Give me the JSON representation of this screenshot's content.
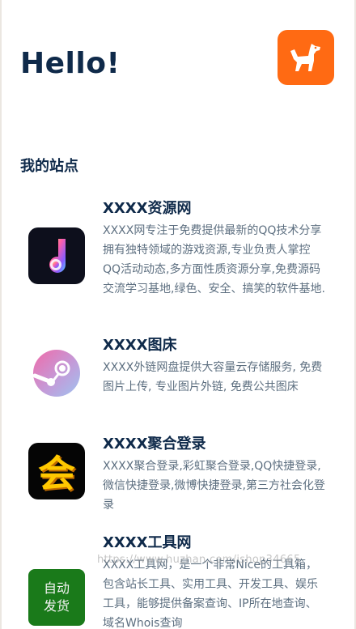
{
  "greeting": "Hello!",
  "section_title": "我的站点",
  "sites": [
    {
      "name": "XXXX资源网",
      "desc": "XXXX网专注于免费提供最新的QQ技术分享拥有独特领域的游戏资源,专业负责人掌控QQ活动动态,多方面性质资源分享,免费源码交流学习基地,绿色、安全、搞笑的软件基地.",
      "icon": "music-note-icon"
    },
    {
      "name": "XXXX图床",
      "desc": "XXXX外链网盘提供大容量云存储服务, 免费图片上传, 专业图片外链, 免费公共图床",
      "icon": "steam-icon"
    },
    {
      "name": "XXXX聚合登录",
      "desc": "XXXX聚合登录,彩虹聚合登录,QQ快捷登录,微信快捷登录,微博快捷登录,第三方社会化登录",
      "icon": "hui-character-icon",
      "icon_text": "会"
    },
    {
      "name": "XXXX工具网",
      "desc": "XXXX工具网，是一个非常Nice的工具箱，包含站长工具、实用工具、开发工具、娱乐工具，能够提供备案查询、IP所在地查询、域名Whois查询",
      "icon": "auto-ship-badge-icon",
      "icon_text_1": "自动",
      "icon_text_2": "发货"
    }
  ],
  "watermark": "https://www.huzhan.com/ishop34665",
  "colors": {
    "title": "#0f2a4a",
    "desc": "#5d6f80",
    "avatar_bg": "#ff6a13",
    "badge_bg": "#1a7a1a"
  }
}
